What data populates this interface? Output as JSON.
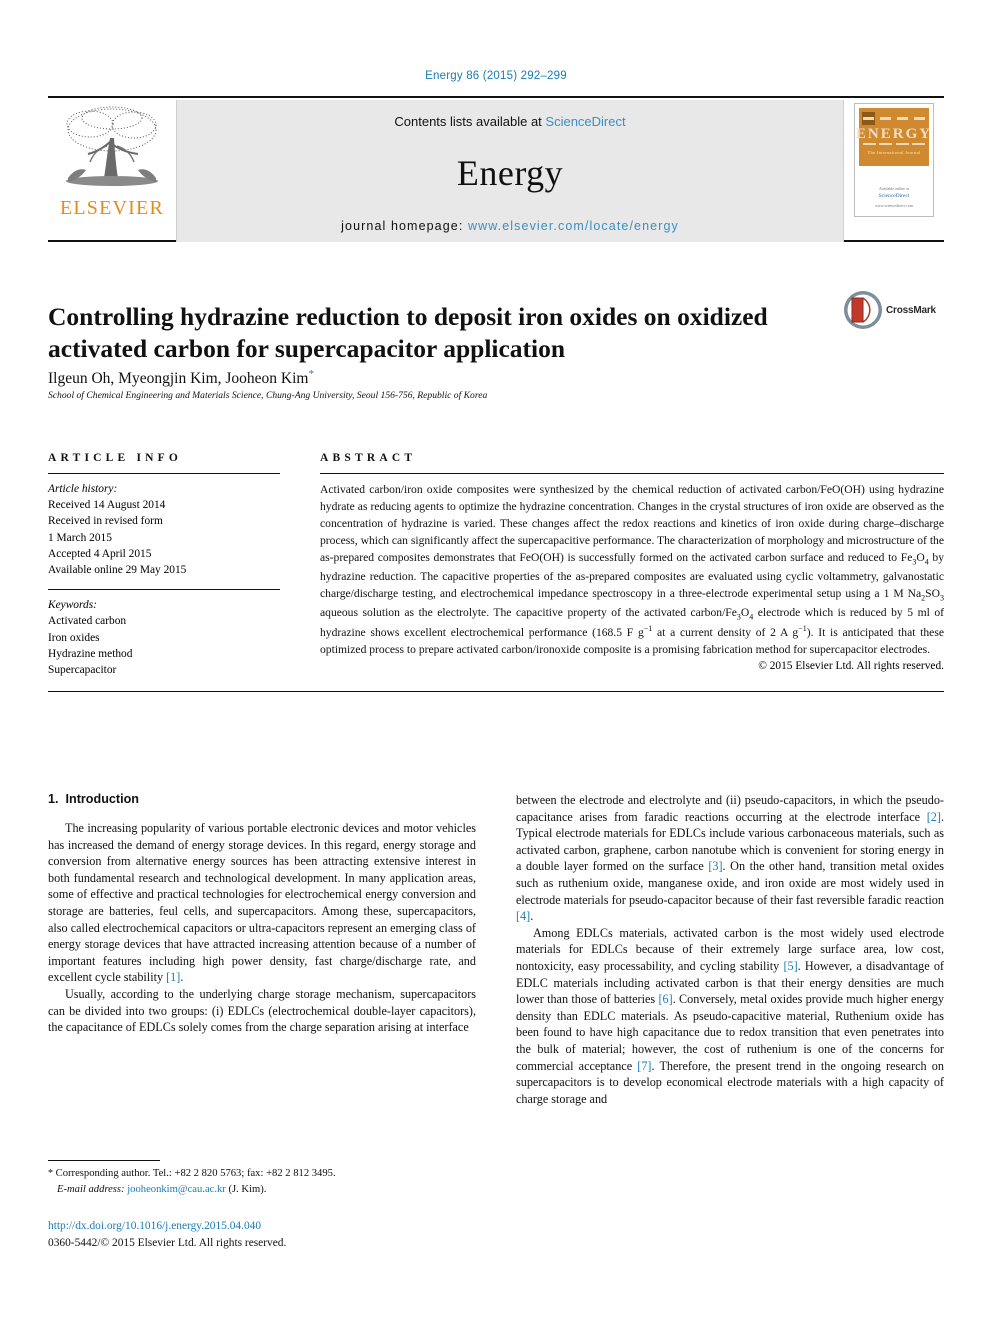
{
  "running_head": "Energy 86 (2015) 292–299",
  "masthead": {
    "contents_prefix": "Contents lists available at ",
    "contents_link": "ScienceDirect",
    "journal_name": "Energy",
    "homepage_prefix": "journal homepage: ",
    "homepage_url": "www.elsevier.com/locate/energy",
    "publisher": "ELSEVIER",
    "cover": {
      "title": "ENERGY",
      "subtitle": "The International Journal",
      "footer_line1": "Available online at",
      "footer_line2": "ScienceDirect",
      "footer_line3": "www.sciencedirect.com"
    }
  },
  "article": {
    "title": "Controlling hydrazine reduction to deposit iron oxides on oxidized activated carbon for supercapacitor application",
    "authors": "Ilgeun Oh, Myeongjin Kim, Jooheon Kim",
    "corresponding_marker": "*",
    "affiliation": "School of Chemical Engineering and Materials Science, Chung-Ang University, Seoul 156-756, Republic of Korea",
    "crossmark_label": "CrossMark"
  },
  "article_info": {
    "heading": "ARTICLE INFO",
    "history_label": "Article history:",
    "history": [
      "Received 14 August 2014",
      "Received in revised form",
      "1 March 2015",
      "Accepted 4 April 2015",
      "Available online 29 May 2015"
    ],
    "keywords_label": "Keywords:",
    "keywords": [
      "Activated carbon",
      "Iron oxides",
      "Hydrazine method",
      "Supercapacitor"
    ]
  },
  "abstract": {
    "heading": "ABSTRACT",
    "part1": "Activated carbon/iron oxide composites were synthesized by the chemical reduction of activated carbon/FeO(OH) using hydrazine hydrate as reducing agents to optimize the hydrazine concentration. Changes in the crystal structures of iron oxide are observed as the concentration of hydrazine is varied. These changes affect the redox reactions and kinetics of iron oxide during charge–discharge process, which can significantly affect the supercapacitive performance. The characterization of morphology and microstructure of the as-prepared composites demonstrates that FeO(OH) is successfully formed on the activated carbon surface and reduced to Fe",
    "sub1": "3",
    "part2": "O",
    "sub2": "4",
    "part3": " by hydrazine reduction. The capacitive properties of the as-prepared composites are evaluated using cyclic voltammetry, galvanostatic charge/discharge testing, and electrochemical impedance spectroscopy in a three-electrode experimental setup using a 1 M Na",
    "sub3": "2",
    "part4": "SO",
    "sub4": "3",
    "part5": " aqueous solution as the electrolyte. The capacitive property of the activated carbon/Fe",
    "sub5": "3",
    "part6": "O",
    "sub6": "4",
    "part7": " electrode which is reduced by 5 ml of hydrazine shows excellent electrochemical performance (168.5 F g",
    "sup1": "−1",
    "part8": " at a current density of 2 A g",
    "sup2": "−1",
    "part9": "). It is anticipated that these optimized process to prepare activated carbon/ironoxide composite is a promising fabrication method for supercapacitor electrodes.",
    "copyright": "© 2015 Elsevier Ltd. All rights reserved."
  },
  "introduction": {
    "number": "1.",
    "heading": "Introduction",
    "left_paragraphs": [
      "The increasing popularity of various portable electronic devices and motor vehicles has increased the demand of energy storage devices. In this regard, energy storage and conversion from alternative energy sources has been attracting extensive interest in both fundamental research and technological development. In many application areas, some of effective and practical technologies for electrochemical energy conversion and storage are batteries, feul cells, and supercapacitors. Among these, supercapacitors, also called electrochemical capacitors or ultra-capacitors represent an emerging class of energy storage devices that have attracted increasing attention because of a number of important features including high power density, fast charge/discharge rate, and excellent cycle stability ",
      "Usually, according to the underlying charge storage mechanism, supercapacitors can be divided into two groups: (i) EDLCs (electrochemical double-layer capacitors), the capacitance of EDLCs solely comes from the charge separation arising at interface"
    ],
    "left_ref1": "[1]",
    "left_tail1": ".",
    "right_paragraphs": [
      "between the electrode and electrolyte and (ii) pseudo-capacitors, in which the pseudo-capacitance arises from faradic reactions occurring at the electrode interface ",
      "Among EDLCs materials, activated carbon is the most widely used electrode materials for EDLCs because of their extremely large surface area, low cost, nontoxicity, easy processability, and cycling stability "
    ],
    "right_ref2": "[2]",
    "right_seg2": ". Typical electrode materials for EDLCs include various carbonaceous materials, such as activated carbon, graphene, carbon nanotube which is convenient for storing energy in a double layer formed on the surface ",
    "right_ref3": "[3]",
    "right_seg3": ". On the other hand, transition metal oxides such as ruthenium oxide, manganese oxide, and iron oxide are most widely used in electrode materials for pseudo-capacitor because of their fast reversible faradic reaction ",
    "right_ref4": "[4]",
    "right_seg4": ".",
    "right_ref5": "[5]",
    "right_seg5": ". However, a disadvantage of EDLC materials including activated carbon is that their energy densities are much lower than those of batteries ",
    "right_ref6": "[6]",
    "right_seg6": ". Conversely, metal oxides provide much higher energy density than EDLC materials. As pseudo-capacitive material, Ruthenium oxide has been found to have high capacitance due to redox transition that even penetrates into the bulk of material; however, the cost of ruthenium is one of the concerns for commercial acceptance ",
    "right_ref7": "[7]",
    "right_seg7": ". Therefore, the present trend in the ongoing research on supercapacitors is to develop economical electrode materials with a high capacity of charge storage and"
  },
  "footnote": {
    "marker": "*",
    "text": " Corresponding author. Tel.: +82 2 820 5763; fax: +82 2 812 3495.",
    "email_label": "E-mail address:",
    "email": "jooheonkim@cau.ac.kr",
    "email_owner": " (J. Kim)."
  },
  "footer": {
    "doi": "http://dx.doi.org/10.1016/j.energy.2015.04.040",
    "issn": "0360-5442/© 2015 Elsevier Ltd. All rights reserved."
  },
  "colors": {
    "link": "#1a7cb8",
    "elsevier_orange": "#e88a1a",
    "masthead_grey": "#e8e8e8",
    "cover_orange": "#cf8a30"
  }
}
